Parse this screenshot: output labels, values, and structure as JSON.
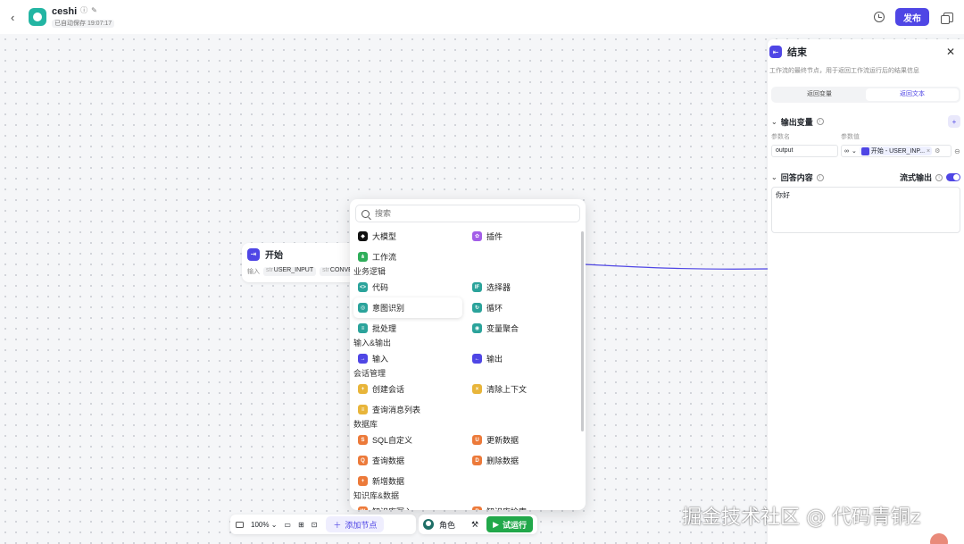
{
  "header": {
    "back_icon": "chevron-left-icon",
    "app_name": "ceshi",
    "autosave": "已自动保存 19:07:17",
    "publish_label": "发布"
  },
  "start_node": {
    "title": "开始",
    "io_label": "输入",
    "vars": [
      {
        "type": "str",
        "name": "USER_INPUT"
      },
      {
        "type": "str",
        "name": "CONVE"
      }
    ]
  },
  "picker": {
    "search_placeholder": "搜索",
    "groups": [
      {
        "title": "",
        "items": [
          {
            "label": "大模型",
            "color": "#111111",
            "glyph": "◆"
          },
          {
            "label": "插件",
            "color": "#a35ee8",
            "glyph": "✿"
          },
          {
            "label": "工作流",
            "color": "#2fae5a",
            "glyph": "⋔"
          }
        ]
      },
      {
        "title": "业务逻辑",
        "items": [
          {
            "label": "代码",
            "color": "#2ba39b",
            "glyph": "<>"
          },
          {
            "label": "选择器",
            "color": "#2ba39b",
            "glyph": "IF"
          },
          {
            "label": "意图识别",
            "color": "#2ba39b",
            "glyph": "◎",
            "hover": true
          },
          {
            "label": "循环",
            "color": "#2ba39b",
            "glyph": "↻"
          },
          {
            "label": "批处理",
            "color": "#2ba39b",
            "glyph": "≡"
          },
          {
            "label": "变量聚合",
            "color": "#2ba39b",
            "glyph": "◉"
          }
        ]
      },
      {
        "title": "输入&输出",
        "items": [
          {
            "label": "输入",
            "color": "#4f46e5",
            "glyph": "→"
          },
          {
            "label": "输出",
            "color": "#4f46e5",
            "glyph": "←"
          }
        ]
      },
      {
        "title": "会话管理",
        "items": [
          {
            "label": "创建会话",
            "color": "#e8b53a",
            "glyph": "+"
          },
          {
            "label": "清除上下文",
            "color": "#e8b53a",
            "glyph": "×"
          },
          {
            "label": "查询消息列表",
            "color": "#e8b53a",
            "glyph": "≡"
          }
        ]
      },
      {
        "title": "数据库",
        "items": [
          {
            "label": "SQL自定义",
            "color": "#ec7a3a",
            "glyph": "S"
          },
          {
            "label": "更新数据",
            "color": "#ec7a3a",
            "glyph": "U"
          },
          {
            "label": "查询数据",
            "color": "#ec7a3a",
            "glyph": "Q"
          },
          {
            "label": "删除数据",
            "color": "#ec7a3a",
            "glyph": "D"
          },
          {
            "label": "新增数据",
            "color": "#ec7a3a",
            "glyph": "+"
          }
        ]
      },
      {
        "title": "知识库&数据",
        "items": [
          {
            "label": "知识库写入",
            "color": "#ec7a3a",
            "glyph": "W"
          },
          {
            "label": "知识库检索",
            "color": "#ec7a3a",
            "glyph": "R"
          }
        ]
      }
    ]
  },
  "panel": {
    "title": "结束",
    "description": "工作流的最终节点，用于返回工作流运行后的结果信息",
    "tabs": [
      "返回变量",
      "返回文本"
    ],
    "active_tab": 1,
    "output_section": "输出变量",
    "col_name": "参数名",
    "col_value": "参数值",
    "var_name": "output",
    "var_ref": "开始 - USER_INP...",
    "answer_section": "回答内容",
    "stream_label": "流式输出",
    "stream_on": true,
    "answer_text": "你好"
  },
  "toolbar": {
    "zoom": "100%",
    "add_node_label": "添加节点",
    "role_label": "角色",
    "run_label": "试运行"
  },
  "watermark": "掘金技术社区 @ 代码青铜z",
  "colors": {
    "accent": "#4f46e5",
    "run": "#22a84a",
    "edge": "#4f46e5"
  }
}
